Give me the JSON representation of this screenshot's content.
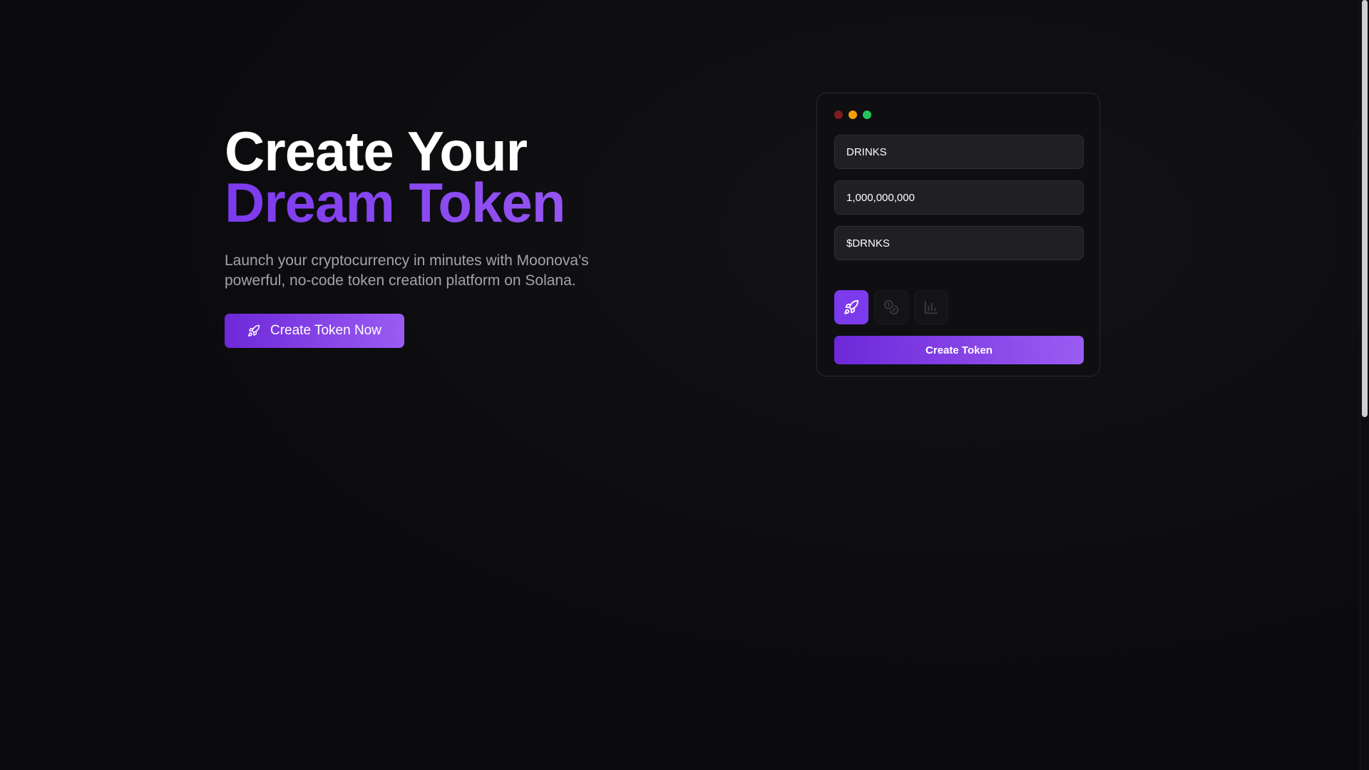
{
  "hero": {
    "title_line1": "Create Your",
    "title_line2": "Dream Token",
    "subtitle": "Launch your cryptocurrency in minutes with Moonova's powerful, no-code token creation platform on Solana.",
    "cta_label": "Create Token Now",
    "cta_icon": "rocket-icon"
  },
  "card": {
    "window_dots": [
      "red",
      "yellow",
      "green"
    ],
    "fields": {
      "token_name": "DRINKS",
      "supply": "1,000,000,000",
      "symbol": "$DRNKS"
    },
    "icon_buttons": [
      {
        "icon": "rocket-icon",
        "active": true
      },
      {
        "icon": "coins-icon",
        "active": false
      },
      {
        "icon": "bar-chart-icon",
        "active": false
      }
    ],
    "submit_label": "Create Token"
  },
  "colors": {
    "background": "#0b0b0d",
    "accent": "#7c3aed",
    "accent_light": "#9b5cf2",
    "field_bg": "#202024",
    "text_muted": "#a3a3ab",
    "dot_red": "#7f1d1d",
    "dot_yellow": "#f59e0b",
    "dot_green": "#22c55e"
  }
}
